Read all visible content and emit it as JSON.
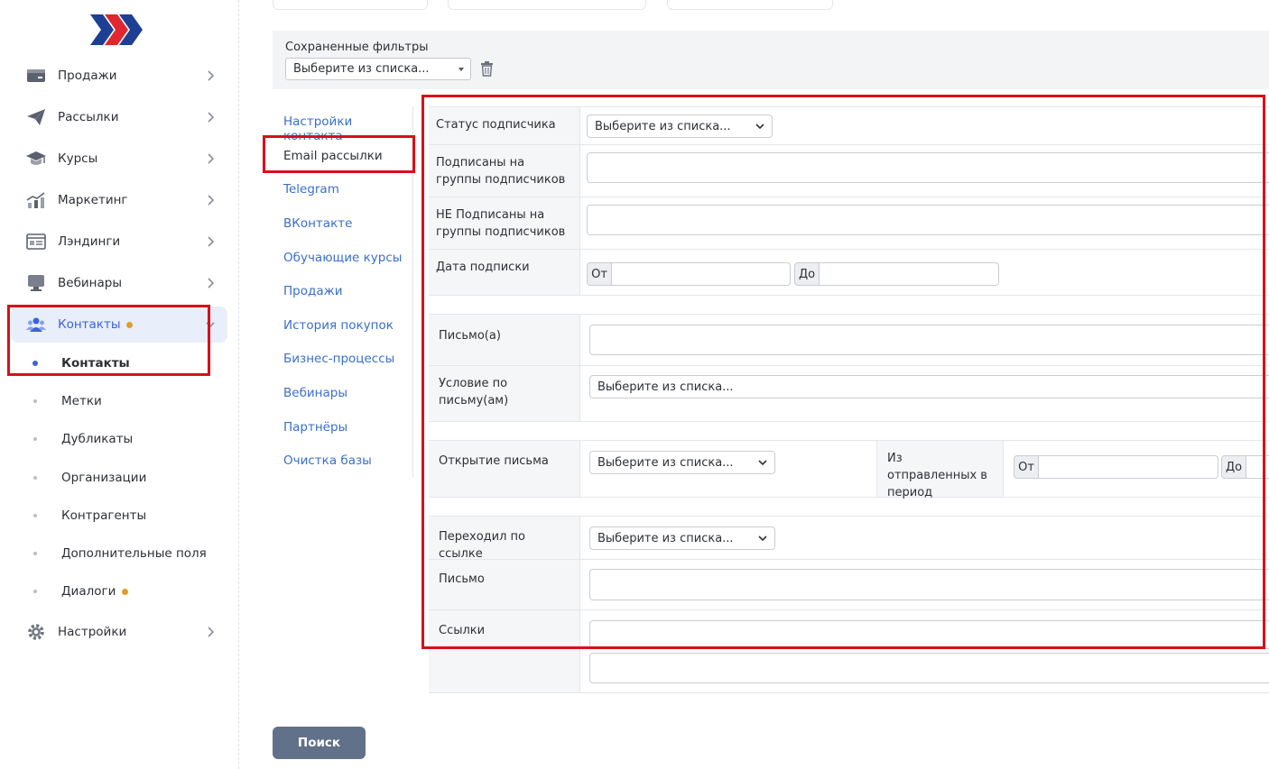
{
  "colors": {
    "accent": "#3a63d8",
    "link": "#3a6fc9",
    "highlight": "#d90f1a",
    "badge": "#e39b2a",
    "button": "#617189",
    "logo_blue": "#1e3f93",
    "logo_red": "#e0262e"
  },
  "sidebar": {
    "items": [
      {
        "label": "Продажи",
        "icon": "cash-register-icon"
      },
      {
        "label": "Рассылки",
        "icon": "paper-plane-icon"
      },
      {
        "label": "Курсы",
        "icon": "graduation-cap-icon"
      },
      {
        "label": "Маркетинг",
        "icon": "bar-chart-icon"
      },
      {
        "label": "Лэндинги",
        "icon": "landing-page-icon"
      },
      {
        "label": "Вебинары",
        "icon": "monitor-icon"
      },
      {
        "label": "Контакты",
        "icon": "users-icon",
        "active": true,
        "badge": true
      },
      {
        "label": "Настройки",
        "icon": "gear-icon"
      }
    ],
    "contacts_sub": [
      {
        "label": "Контакты",
        "active": true
      },
      {
        "label": "Метки"
      },
      {
        "label": "Дубликаты"
      },
      {
        "label": "Организации"
      },
      {
        "label": "Контрагенты"
      },
      {
        "label": "Дополнительные поля"
      },
      {
        "label": "Диалоги",
        "badge": true
      }
    ]
  },
  "saved_filters": {
    "label": "Сохраненные фильтры",
    "select_value": "Выберите из списка..."
  },
  "filter_menu": {
    "items": [
      "Настройки контакта",
      "Email рассылки",
      "Telegram",
      "ВКонтакте",
      "Обучающие курсы",
      "Продажи",
      "История покупок",
      "Бизнес-процессы",
      "Вебинары",
      "Партнёры",
      "Очистка базы"
    ],
    "active_index": 1
  },
  "form": {
    "subscriber_status": {
      "label": "Статус подписчика",
      "value": "Выберите из списка..."
    },
    "subscribed_groups": {
      "label": "Подписаны на группы подписчиков"
    },
    "not_subscribed_groups": {
      "label": "НЕ Подписаны на группы подписчиков"
    },
    "subscription_date": {
      "label": "Дата подписки",
      "from": "От",
      "to": "До"
    },
    "letters": {
      "label": "Письмо(а)"
    },
    "letter_condition": {
      "label": "Условие по письму(ам)",
      "value": "Выберите из списка..."
    },
    "letter_open": {
      "label": "Открытие письма",
      "value": "Выберите из списка..."
    },
    "sent_period": {
      "label": "Из отправленных в период",
      "from": "От",
      "to": "До"
    },
    "link_click": {
      "label": "Переходил по ссылке",
      "value": "Выберите из списка..."
    },
    "letter": {
      "label": "Письмо"
    },
    "links": {
      "label": "Ссылки"
    }
  },
  "search_button": {
    "label": "Поиск"
  }
}
